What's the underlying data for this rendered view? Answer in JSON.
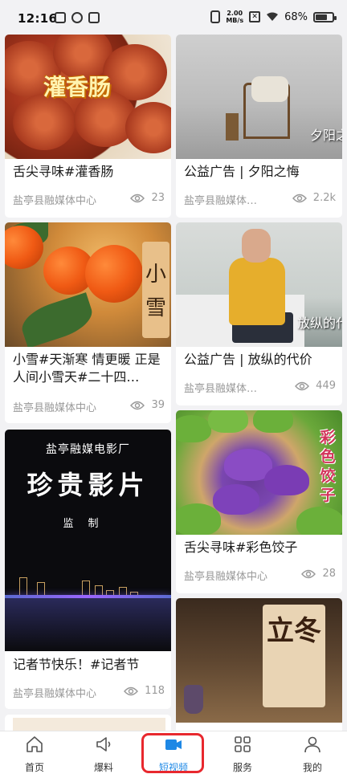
{
  "status_bar": {
    "time": "12:16",
    "net_speed_value": "2.00",
    "net_speed_unit": "MB/s",
    "battery": "68%",
    "battery_level": 0.68
  },
  "feed": {
    "cards": [
      {
        "title": "舌尖寻味#灌香肠",
        "source": "盐亭县融媒体中心",
        "views": "23",
        "thumb_text": "灌香肠"
      },
      {
        "title": "公益广告 | 夕阳之悔",
        "source": "盐亭县融媒体…",
        "views": "2.2k",
        "thumb_text": "夕阳之"
      },
      {
        "title": "小雪#天渐寒 情更暖 正是人间小雪天#二十四…",
        "source": "盐亭县融媒体中心",
        "views": "39",
        "thumb_text": "小雪"
      },
      {
        "title": "公益广告 | 放纵的代价",
        "source": "盐亭县融媒体…",
        "views": "449",
        "thumb_text": "放纵的代"
      },
      {
        "title": "记者节快乐！#记者节",
        "source": "盐亭县融媒体中心",
        "views": "118",
        "thumb_lines": [
          "盐亭融媒电影厂",
          "珍贵影片",
          "监制"
        ]
      },
      {
        "title": "舌尖寻味#彩色饺子",
        "source": "盐亭县融媒体中心",
        "views": "28",
        "thumb_text": "彩色饺子"
      },
      {
        "title": "",
        "source": "",
        "views": "",
        "thumb_text": "立冬"
      }
    ]
  },
  "bottom_nav": {
    "items": [
      {
        "label": "首页",
        "icon": "home-icon"
      },
      {
        "label": "爆料",
        "icon": "speaker-icon"
      },
      {
        "label": "短视频",
        "icon": "video-icon"
      },
      {
        "label": "服务",
        "icon": "grid-icon"
      },
      {
        "label": "我的",
        "icon": "user-icon"
      }
    ],
    "active_index": 2,
    "active_color": "#1e88e5",
    "highlight_color": "#e8282e"
  }
}
